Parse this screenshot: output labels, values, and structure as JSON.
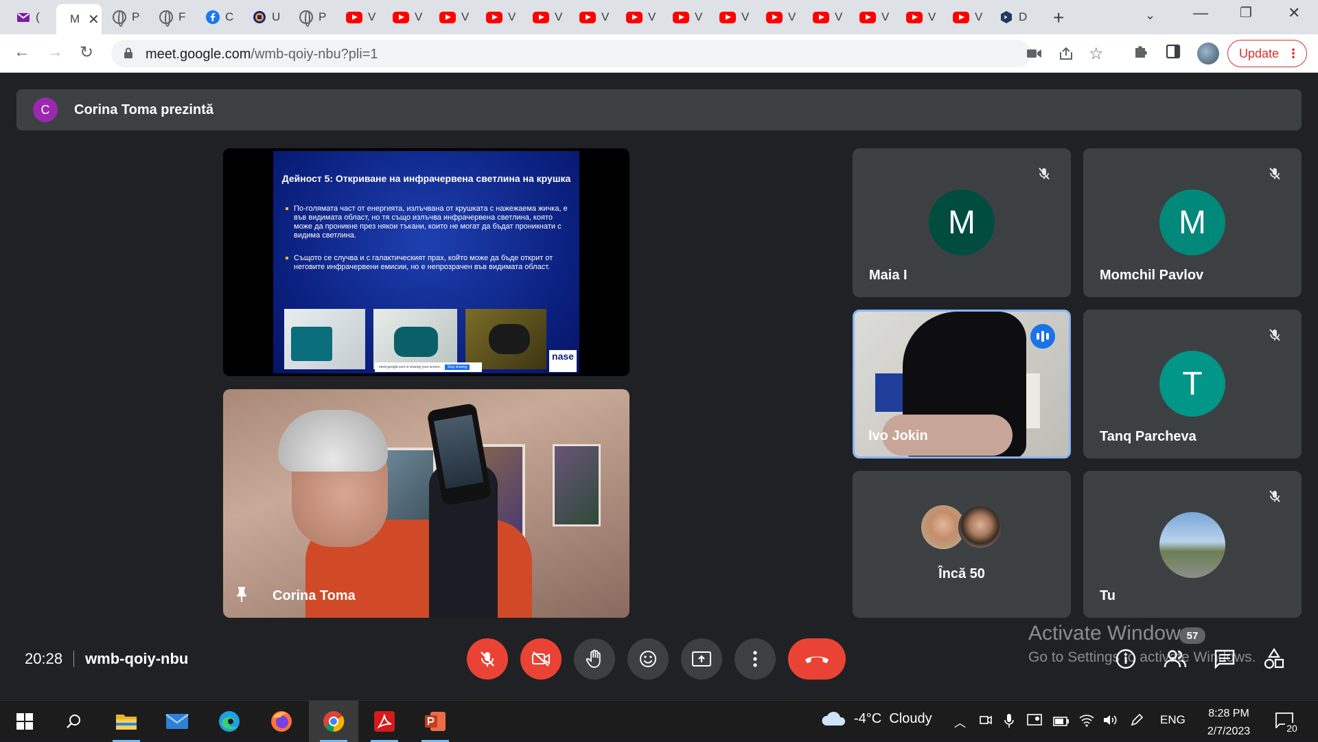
{
  "browser": {
    "tabs": [
      {
        "icon": "gmail-icon",
        "title": "(",
        "active": false
      },
      {
        "icon": "meet-icon",
        "title": "M",
        "active": true
      },
      {
        "icon": "globe-icon",
        "title": "P",
        "active": false
      },
      {
        "icon": "globe-icon",
        "title": "F",
        "active": false
      },
      {
        "icon": "facebook-icon",
        "title": "C",
        "active": false
      },
      {
        "icon": "university-icon",
        "title": "U",
        "active": false
      },
      {
        "icon": "globe-icon",
        "title": "P",
        "active": false
      },
      {
        "icon": "youtube-icon",
        "title": "V",
        "active": false
      },
      {
        "icon": "youtube-icon",
        "title": "V",
        "active": false
      },
      {
        "icon": "youtube-icon",
        "title": "V",
        "active": false
      },
      {
        "icon": "youtube-icon",
        "title": "V",
        "active": false
      },
      {
        "icon": "youtube-icon",
        "title": "V",
        "active": false
      },
      {
        "icon": "youtube-icon",
        "title": "V",
        "active": false
      },
      {
        "icon": "youtube-icon",
        "title": "V",
        "active": false
      },
      {
        "icon": "youtube-icon",
        "title": "V",
        "active": false
      },
      {
        "icon": "youtube-icon",
        "title": "V",
        "active": false
      },
      {
        "icon": "youtube-icon",
        "title": "V",
        "active": false
      },
      {
        "icon": "youtube-icon",
        "title": "V",
        "active": false
      },
      {
        "icon": "youtube-icon",
        "title": "V",
        "active": false
      },
      {
        "icon": "youtube-icon",
        "title": "V",
        "active": false
      },
      {
        "icon": "youtube-icon",
        "title": "V",
        "active": false
      },
      {
        "icon": "hexagon-icon",
        "title": "D",
        "active": false
      }
    ],
    "url_host": "meet.google.com",
    "url_path": "/wmb-qoiy-nbu?pli=1",
    "update_label": "Update"
  },
  "meet": {
    "presenting_initial": "C",
    "presenting_text": "Corina Toma prezintă",
    "slide": {
      "title": "Дейност 5: Откриване на инфрачервена светлина на крушка",
      "bullet1": "По-голямата част от енергията, излъчвана от крушката с нажежаема жичка, е във видимата област, но тя също излъчва инфрачервена светлина, която може да проникне през някои тъкани, които не могат да бъдат проникнати с видима светлина.",
      "bullet2": "Същото се случва и с галактическият прах, който може да бъде открит от неговите инфрачервени емисии, но е непрозрачен във видимата област.",
      "sharing_text": "meet.google.com is sharing your screen.",
      "stop_sharing": "Stop sharing",
      "logo_text": "nase"
    },
    "main_video_name": "Corina Toma",
    "participants": {
      "maia": {
        "initial": "M",
        "name": "Maia I",
        "color": "#004d40"
      },
      "momchil": {
        "initial": "M",
        "name": "Momchil Pavlov",
        "color": "#00897b"
      },
      "ivo": {
        "name": "Ivo Jokin"
      },
      "tanq": {
        "initial": "T",
        "name": "Tanq Parcheva",
        "color": "#009688"
      },
      "more": {
        "label": "Încă 50"
      },
      "tu": {
        "name": "Tu"
      }
    },
    "time": "20:28",
    "meeting_code": "wmb-qoiy-nbu",
    "people_count": "57",
    "watermark_line1": "Activate Windows",
    "watermark_line2": "Go to Settings to activate Windows."
  },
  "taskbar": {
    "weather_temp": "-4°C",
    "weather_desc": "Cloudy",
    "lang": "ENG",
    "time": "8:28 PM",
    "date": "2/7/2023",
    "notifications": "20"
  }
}
